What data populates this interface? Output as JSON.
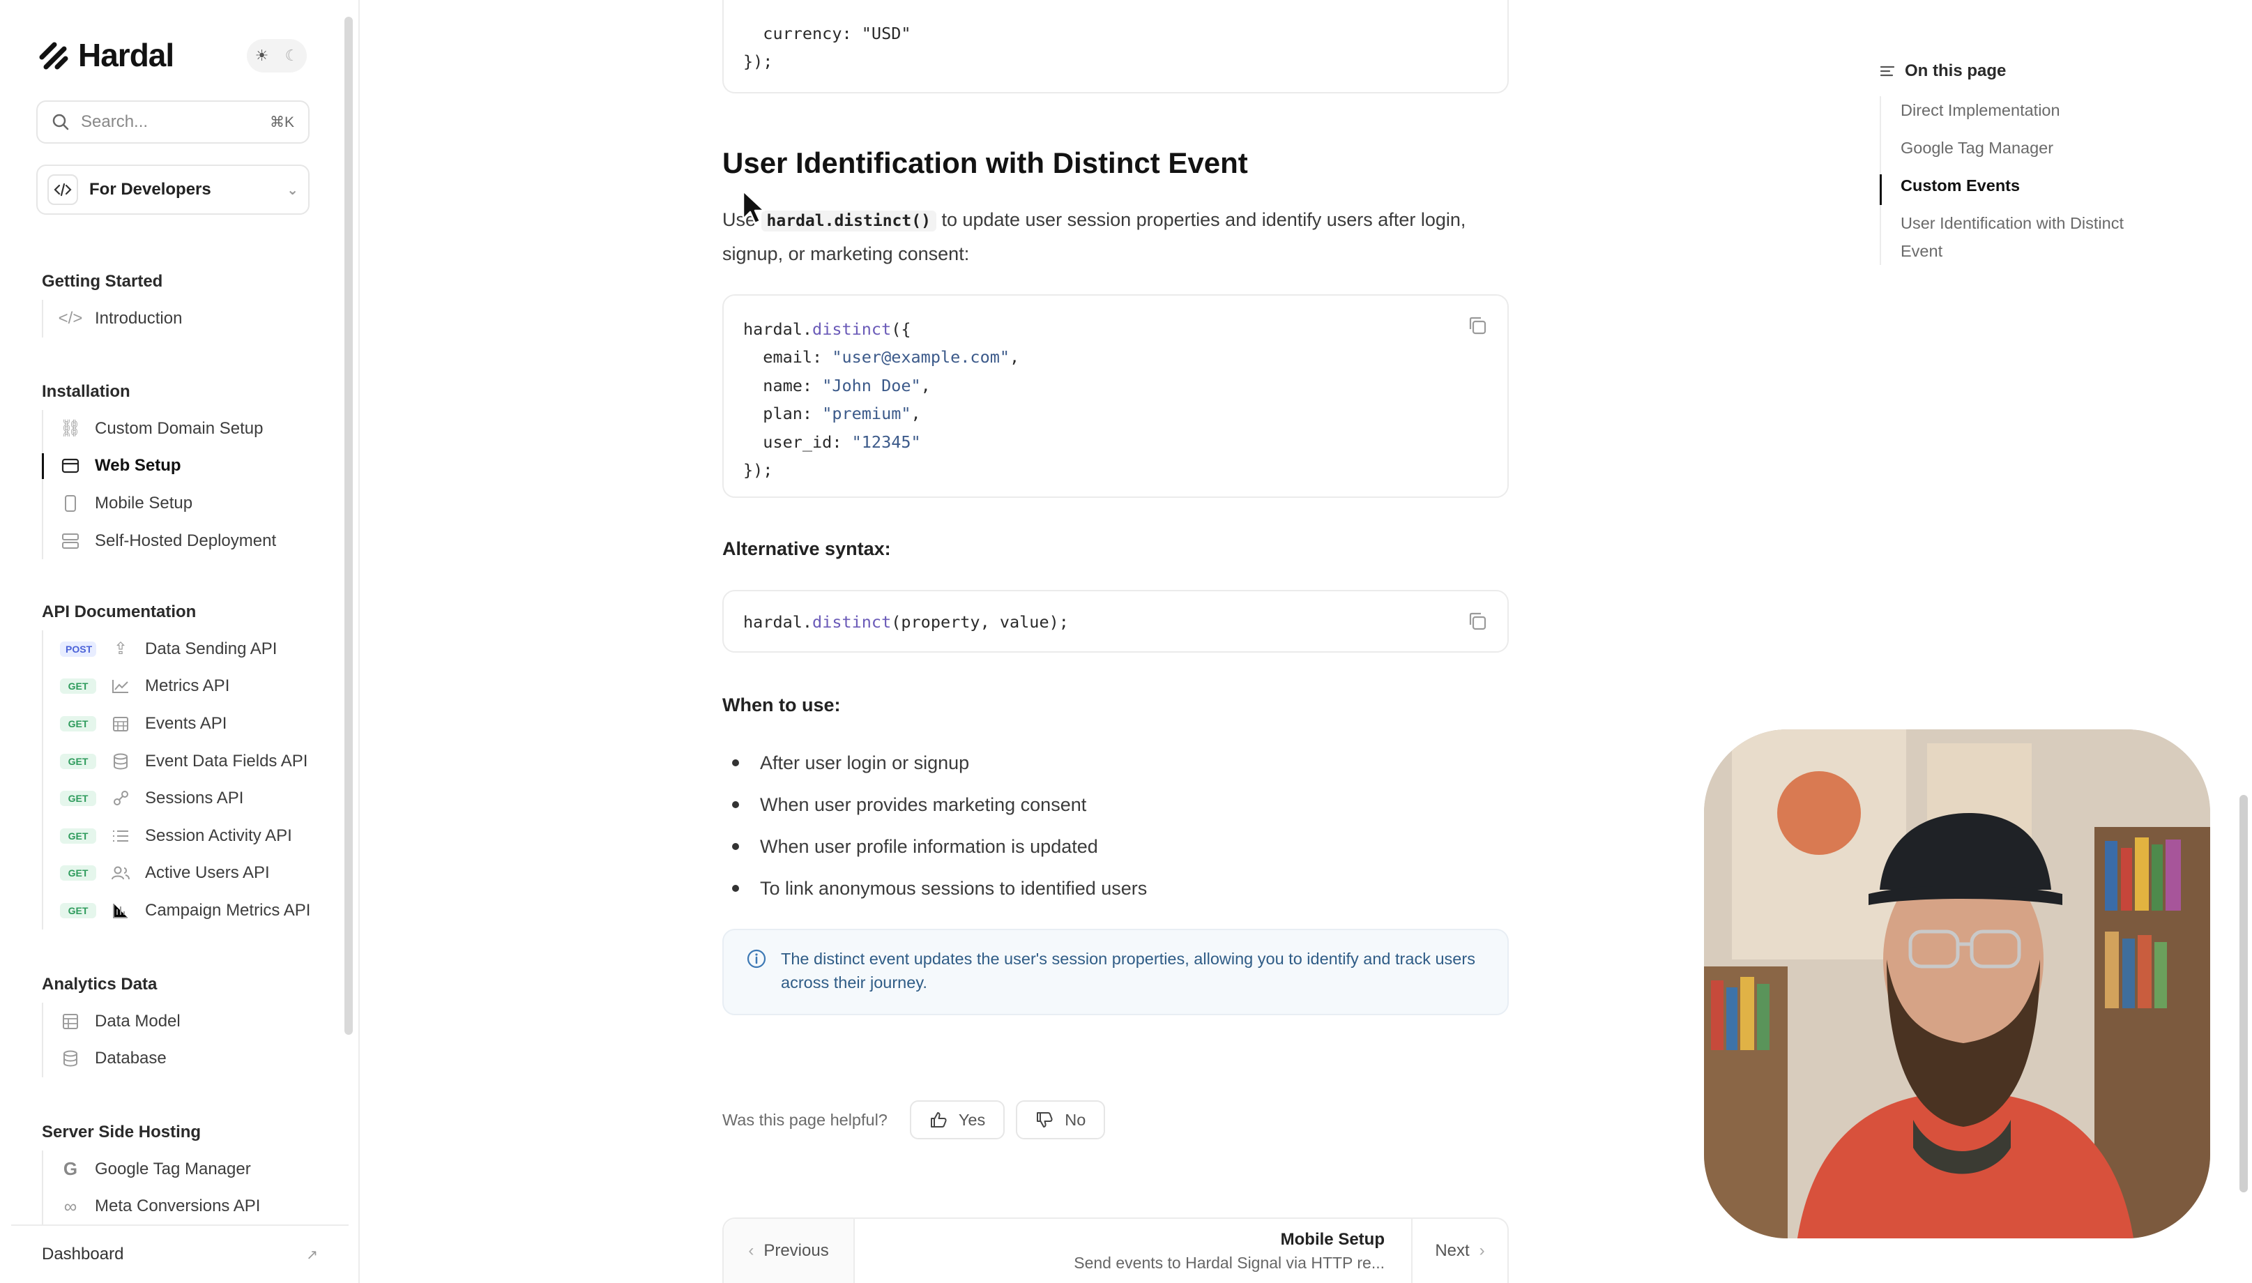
{
  "brand": {
    "name": "Hardal"
  },
  "search": {
    "placeholder": "Search...",
    "shortcut": "⌘K"
  },
  "dev_select": {
    "label": "For Developers"
  },
  "sidebar": {
    "sections": [
      {
        "heading": "Getting Started",
        "items": [
          {
            "label": "Introduction",
            "icon": "code-icon"
          }
        ]
      },
      {
        "heading": "Installation",
        "items": [
          {
            "label": "Custom Domain Setup",
            "icon": "link-icon"
          },
          {
            "label": "Web Setup",
            "icon": "browser-icon",
            "active": true
          },
          {
            "label": "Mobile Setup",
            "icon": "mobile-icon"
          },
          {
            "label": "Self-Hosted Deployment",
            "icon": "server-icon"
          }
        ]
      },
      {
        "heading": "API Documentation",
        "items": [
          {
            "method": "POST",
            "label": "Data Sending API",
            "icon": "upload-icon"
          },
          {
            "method": "GET",
            "label": "Metrics API",
            "icon": "line-chart-icon"
          },
          {
            "method": "GET",
            "label": "Events API",
            "icon": "calendar-icon"
          },
          {
            "method": "GET",
            "label": "Event Data Fields API",
            "icon": "database-icon"
          },
          {
            "method": "GET",
            "label": "Sessions API",
            "icon": "sessions-icon"
          },
          {
            "method": "GET",
            "label": "Session Activity API",
            "icon": "list-icon"
          },
          {
            "method": "GET",
            "label": "Active Users API",
            "icon": "users-icon"
          },
          {
            "method": "GET",
            "label": "Campaign Metrics API",
            "icon": "bar-chart-icon"
          }
        ]
      },
      {
        "heading": "Analytics Data",
        "items": [
          {
            "label": "Data Model",
            "icon": "table-icon"
          },
          {
            "label": "Database",
            "icon": "database-icon"
          }
        ]
      },
      {
        "heading": "Server Side Hosting",
        "items": [
          {
            "label": "Google Tag Manager",
            "icon": "google-icon"
          },
          {
            "label": "Meta Conversions API",
            "icon": "meta-icon"
          }
        ]
      }
    ],
    "footer": "Dashboard"
  },
  "main": {
    "top_code": [
      "  currency: \"USD\"",
      "});"
    ],
    "section_title": "User Identification with Distinct Event",
    "intro_before": "Use ",
    "intro_code": "hardal.distinct()",
    "intro_after": " to update user session properties and identify users after login, signup, or marketing consent:",
    "code_block": [
      {
        "pre": "hardal.",
        "fn": "distinct",
        "post": "({"
      },
      {
        "pre": "  email: ",
        "str": "\"user@example.com\"",
        "post": ","
      },
      {
        "pre": "  name: ",
        "str": "\"John Doe\"",
        "post": ","
      },
      {
        "pre": "  plan: ",
        "str": "\"premium\"",
        "post": ","
      },
      {
        "pre": "  user_id: ",
        "str": "\"12345\"",
        "post": ""
      },
      {
        "pre": "});",
        "post": ""
      }
    ],
    "alt_heading": "Alternative syntax:",
    "alt_code": {
      "pre": "hardal.",
      "fn": "distinct",
      "post": "(property, value);"
    },
    "when_heading": "When to use:",
    "when_items": [
      "After user login or signup",
      "When user provides marketing consent",
      "When user profile information is updated",
      "To link anonymous sessions to identified users"
    ],
    "info": "The distinct event updates the user's session properties, allowing you to identify and track users across their journey.",
    "helpful": {
      "question": "Was this page helpful?",
      "yes": "Yes",
      "no": "No"
    },
    "pager": {
      "prev": "Previous",
      "title": "Mobile Setup",
      "subtitle": "Send events to Hardal Signal via HTTP re...",
      "next": "Next"
    }
  },
  "toc": {
    "heading": "On this page",
    "items": [
      {
        "label": "Direct Implementation"
      },
      {
        "label": "Google Tag Manager"
      },
      {
        "label": "Custom Events",
        "active": true
      },
      {
        "label": "User Identification with Distinct Event"
      }
    ]
  },
  "colors": {
    "accent": "#111111",
    "info_bg": "#f5f9fc",
    "info_text": "#2f5c86",
    "get_badge": "#2e9b5c",
    "post_badge": "#4b62d8"
  }
}
